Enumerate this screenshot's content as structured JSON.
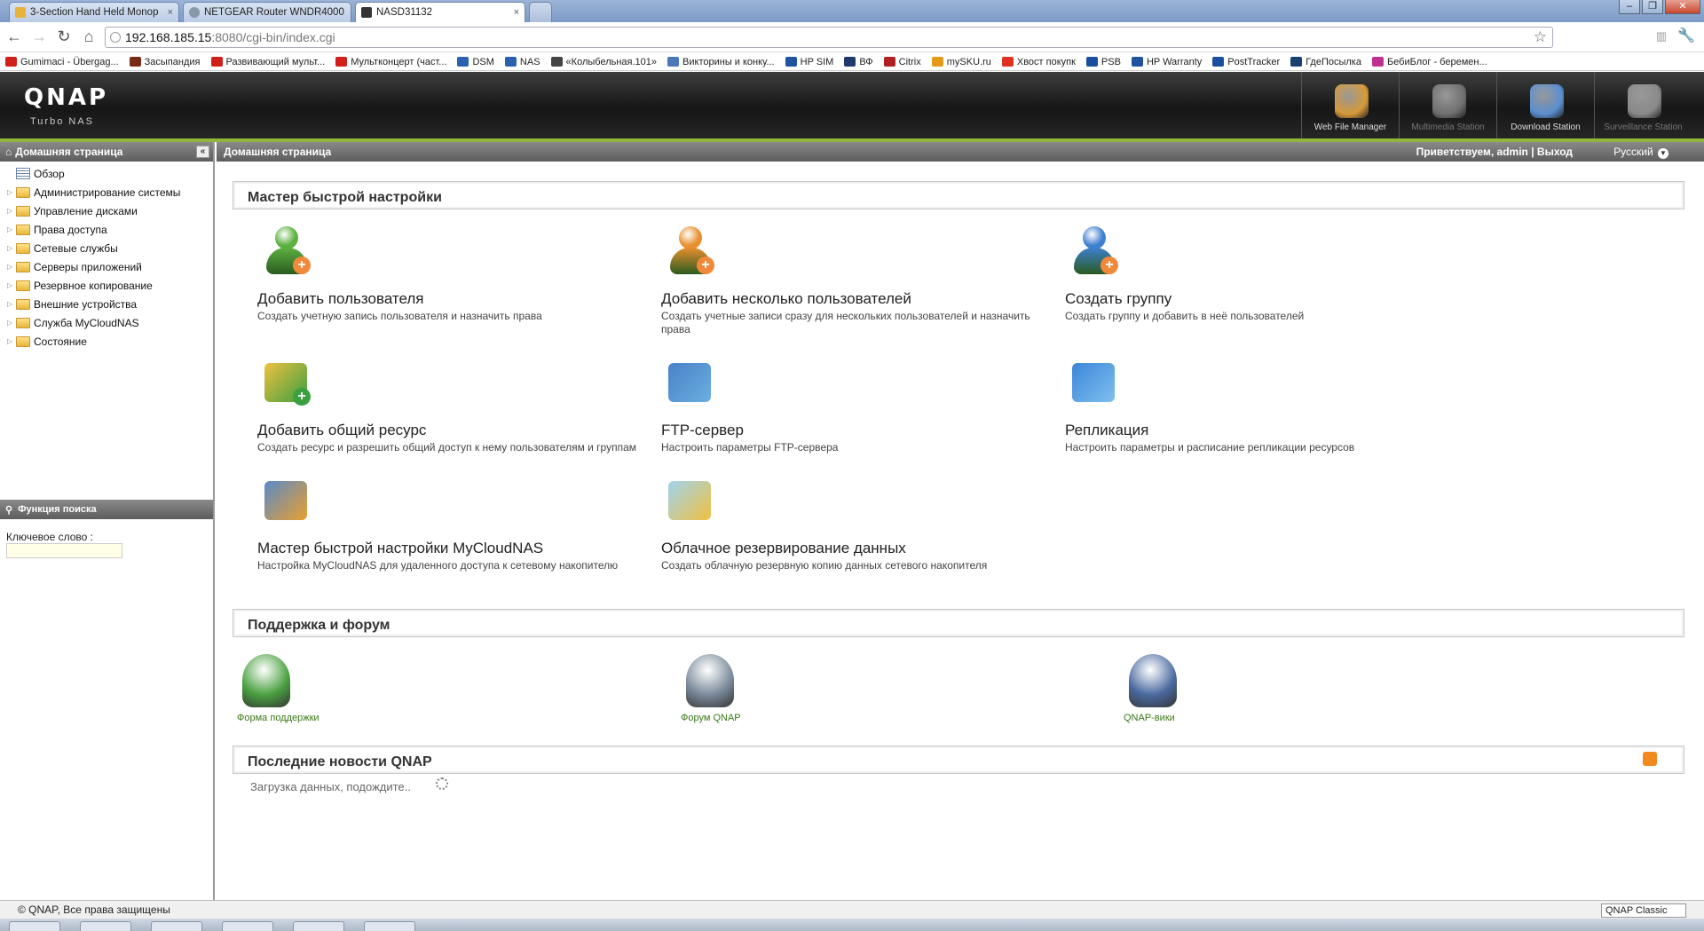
{
  "browser": {
    "tabs": [
      {
        "title": "3-Section Hand Held Monop",
        "close": "×"
      },
      {
        "title": "NETGEAR Router WNDR4000",
        "close": "×"
      },
      {
        "title": "NASD31132",
        "close": "×"
      }
    ],
    "url_host": "192.168.185.15",
    "url_path": ":8080/cgi-bin/index.cgi",
    "window_buttons": [
      "–",
      "❐",
      "✕"
    ],
    "bookmarks": [
      {
        "label": "Gumimaci - Übergag...",
        "color": "#d0201a"
      },
      {
        "label": "Засыпандия",
        "color": "#7a2b16"
      },
      {
        "label": "Развивающий мульт...",
        "color": "#d0201a"
      },
      {
        "label": "Мультконцерт (част...",
        "color": "#d0201a"
      },
      {
        "label": "DSM",
        "color": "#2a62b0"
      },
      {
        "label": "NAS",
        "color": "#2a62b0"
      },
      {
        "label": "«Колыбельная.101»",
        "color": "#444444"
      },
      {
        "label": "Викторины и конку...",
        "color": "#4a78b8"
      },
      {
        "label": "HP SIM",
        "color": "#2053a0"
      },
      {
        "label": "ВФ",
        "color": "#203a70"
      },
      {
        "label": "Citrix",
        "color": "#b02020"
      },
      {
        "label": "mySKU.ru",
        "color": "#e39a1a"
      },
      {
        "label": "Хвост покупк",
        "color": "#e03020"
      },
      {
        "label": "PSB",
        "color": "#1a4fa0"
      },
      {
        "label": "HP Warranty",
        "color": "#2053a0"
      },
      {
        "label": "PostTracker",
        "color": "#1a4fa0"
      },
      {
        "label": "ГдеПосылка",
        "color": "#1a3f70"
      },
      {
        "label": "БебиБлог - беремен...",
        "color": "#c03090"
      }
    ]
  },
  "header": {
    "logo": "QNAP",
    "subtitle": "Turbo NAS",
    "stations": [
      {
        "label": "Web File Manager",
        "icon": "web-file-manager-icon",
        "color": "#d79a3a"
      },
      {
        "label": "Multimedia Station",
        "icon": "multimedia-station-icon",
        "color": "#707070"
      },
      {
        "label": "Download Station",
        "icon": "download-station-icon",
        "color": "#5b8fd0"
      },
      {
        "label": "Surveillance Station",
        "icon": "surveillance-station-icon",
        "color": "#8a8a8a"
      }
    ]
  },
  "sidebar": {
    "title": "Домашняя страница",
    "items": [
      {
        "label": "Обзор",
        "type": "overview"
      },
      {
        "label": "Администрирование системы"
      },
      {
        "label": "Управление дисками"
      },
      {
        "label": "Права доступа"
      },
      {
        "label": "Сетевые службы"
      },
      {
        "label": "Серверы приложений"
      },
      {
        "label": "Резервное копирование"
      },
      {
        "label": "Внешние устройства"
      },
      {
        "label": "Служба MyCloudNAS"
      },
      {
        "label": "Состояние"
      }
    ],
    "search_title": "Функция поиска",
    "keyword_label": "Ключевое слово :",
    "keyword_value": ""
  },
  "main": {
    "breadcrumb": "Домашняя страница",
    "welcome": "Приветствуем,  admin | Выход",
    "language": "Русский",
    "quick_title": "Мастер быстрой настройки",
    "wizards": [
      {
        "title": "Добавить пользователя",
        "desc": "Создать учетную запись пользователя и назначить права",
        "icon": "add-user-icon"
      },
      {
        "title": "Добавить несколько пользователей",
        "desc": "Создать учетные записи сразу для нескольких пользователей и назначить права",
        "icon": "add-multiple-users-icon"
      },
      {
        "title": "Создать группу",
        "desc": "Создать группу и добавить в неё пользователей",
        "icon": "create-group-icon"
      },
      {
        "title": "Добавить общий ресурс",
        "desc": "Создать ресурс и разрешить общий доступ к нему пользователям и группам",
        "icon": "add-share-icon"
      },
      {
        "title": "FTP-сервер",
        "desc": "Настроить параметры FTP-сервера",
        "icon": "ftp-server-icon"
      },
      {
        "title": "Репликация",
        "desc": "Настроить параметры и расписание репликации ресурсов",
        "icon": "replication-icon"
      },
      {
        "title": "Мастер быстрой настройки MyCloudNAS",
        "desc": "Настройка MyCloudNAS для удаленного доступа к сетевому накопителю",
        "icon": "mycloudnas-wizard-icon"
      },
      {
        "title": "Облачное резервирование данных",
        "desc": "Создать облачную резервную копию данных сетевого накопителя",
        "icon": "cloud-backup-icon"
      }
    ],
    "support_title": "Поддержка и форум",
    "support": [
      {
        "label": "Форма поддержки",
        "icon": "support-form-icon"
      },
      {
        "label": "Форум QNAP",
        "icon": "qnap-forum-icon"
      },
      {
        "label": "QNAP-вики",
        "icon": "qnap-wiki-icon"
      }
    ],
    "news_title": "Последние новости QNAP",
    "loading": "Загрузка данных, подождите.."
  },
  "footer": {
    "copyright": "© QNAP, Все права защищены",
    "theme": "QNAP Classic"
  }
}
